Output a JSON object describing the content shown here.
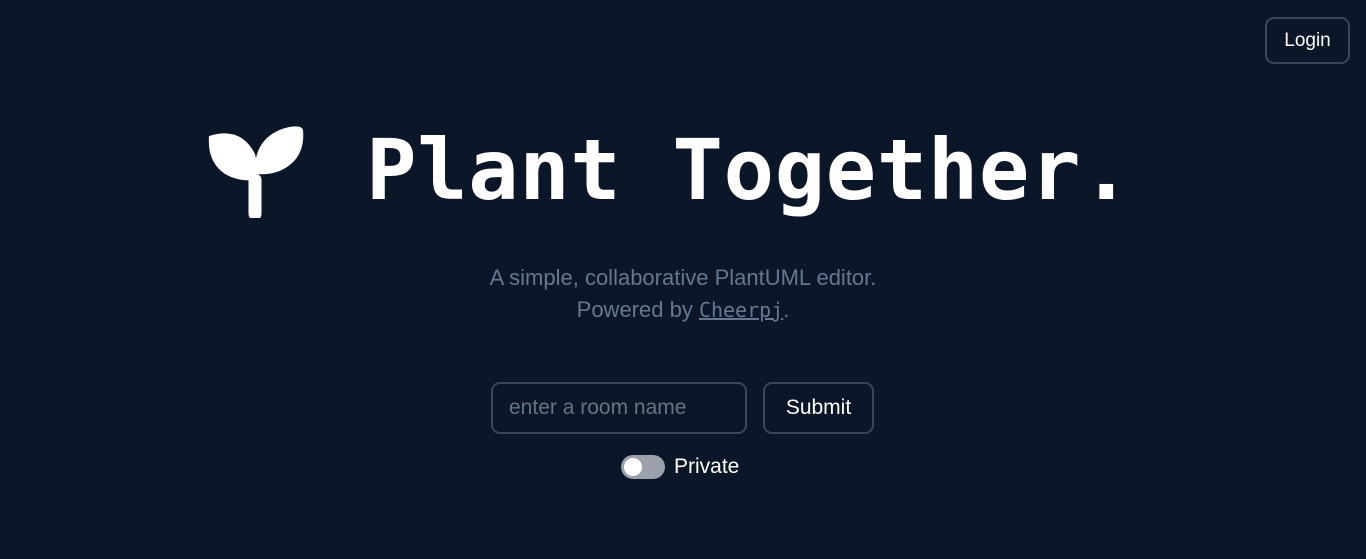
{
  "header": {
    "login_label": "Login"
  },
  "hero": {
    "logo_icon": "sprout-icon",
    "title": "Plant Together."
  },
  "subtitle": {
    "line1": "A simple, collaborative PlantUML editor.",
    "line2_prefix": "Powered by ",
    "link_text": "Cheerpj",
    "line2_suffix": "."
  },
  "room_form": {
    "input_placeholder": "enter a room name",
    "input_value": "",
    "submit_label": "Submit",
    "private_label": "Private",
    "private_enabled": false
  },
  "colors": {
    "background": "#0b1629",
    "border": "#3a4556",
    "muted_text": "#66788f",
    "toggle_off": "#9aa1ab"
  }
}
